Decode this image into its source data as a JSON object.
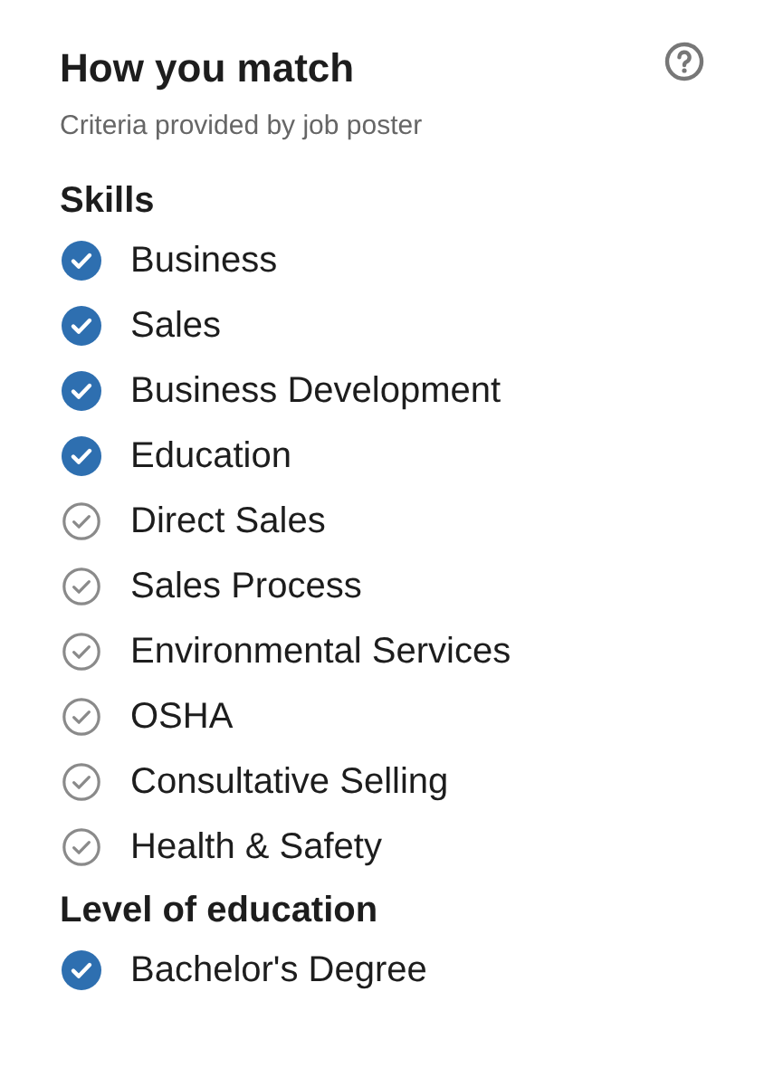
{
  "title": "How you match",
  "subtitle": "Criteria provided by job poster",
  "sections": [
    {
      "heading": "Skills",
      "items": [
        {
          "label": "Business",
          "matched": true
        },
        {
          "label": "Sales",
          "matched": true
        },
        {
          "label": "Business Development",
          "matched": true
        },
        {
          "label": "Education",
          "matched": true
        },
        {
          "label": "Direct Sales",
          "matched": false
        },
        {
          "label": "Sales Process",
          "matched": false
        },
        {
          "label": "Environmental Services",
          "matched": false
        },
        {
          "label": "OSHA",
          "matched": false
        },
        {
          "label": "Consultative Selling",
          "matched": false
        },
        {
          "label": "Health & Safety",
          "matched": false
        }
      ]
    },
    {
      "heading": "Level of education",
      "items": [
        {
          "label": "Bachelor's Degree",
          "matched": true
        }
      ]
    }
  ]
}
